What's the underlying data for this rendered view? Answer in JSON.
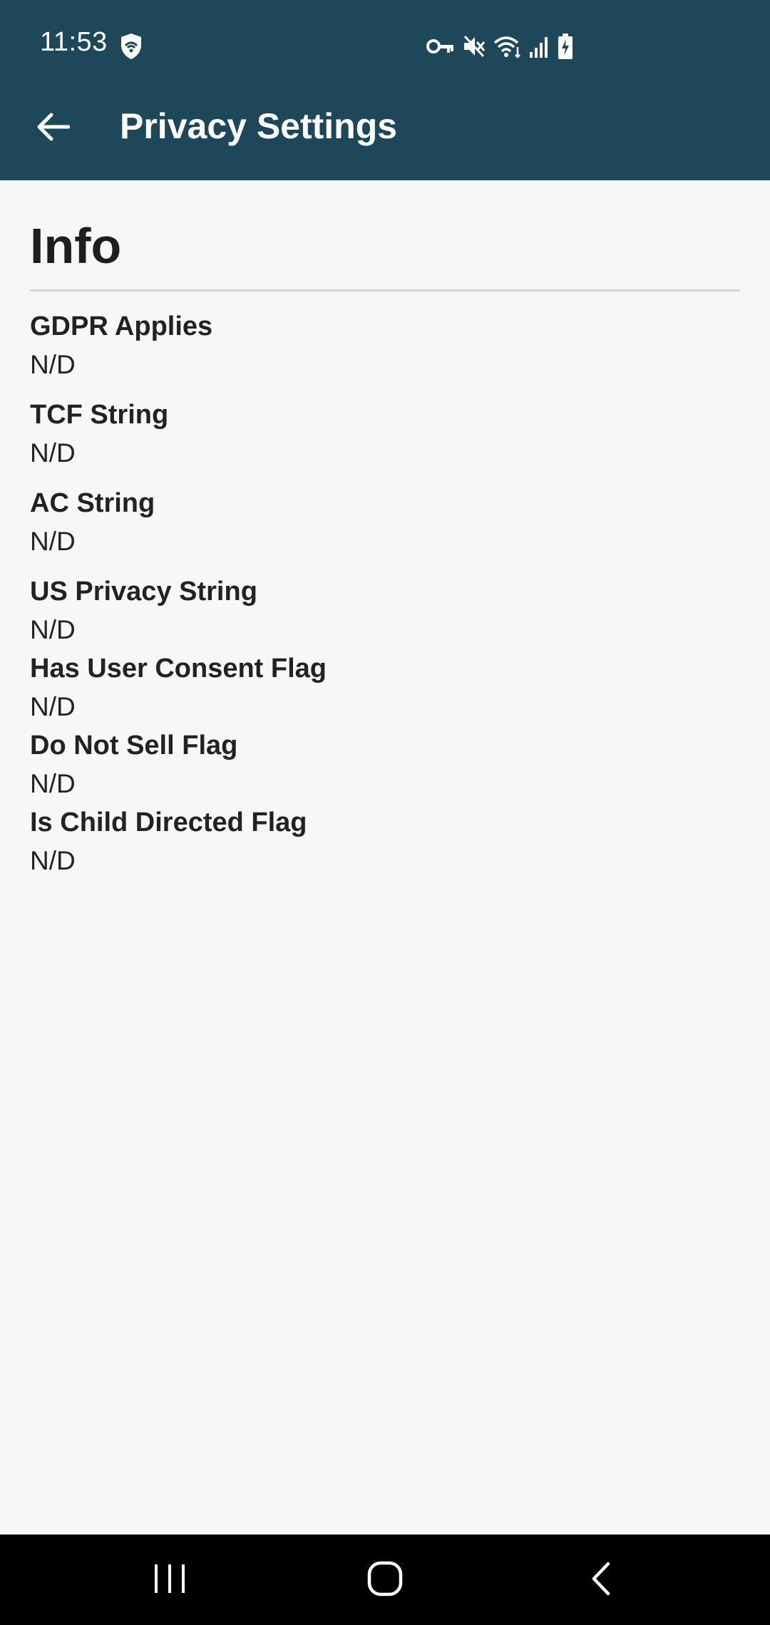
{
  "status_bar": {
    "time": "11:53",
    "icons": [
      "shield-icon",
      "vpn-key-icon",
      "mute-icon",
      "wifi-icon",
      "signal-icon",
      "battery-charging-icon"
    ]
  },
  "app_bar": {
    "title": "Privacy Settings",
    "back_icon": "arrow-left-icon"
  },
  "section": {
    "title": "Info"
  },
  "rows": [
    {
      "label": "GDPR Applies",
      "value": "N/D"
    },
    {
      "label": "TCF String",
      "value": "N/D"
    },
    {
      "label": "AC String",
      "value": "N/D"
    },
    {
      "label": "US Privacy String",
      "value": "N/D"
    },
    {
      "label": "Has User Consent Flag",
      "value": "N/D"
    },
    {
      "label": "Do Not Sell Flag",
      "value": "N/D"
    },
    {
      "label": "Is Child Directed Flag",
      "value": "N/D"
    }
  ],
  "nav_bar": {
    "buttons": [
      "recent-apps-icon",
      "home-icon",
      "back-icon"
    ]
  },
  "colors": {
    "app_bar": "#1f475a",
    "background": "#f7f7f7",
    "text": "#222222",
    "nav_bar": "#000000"
  }
}
